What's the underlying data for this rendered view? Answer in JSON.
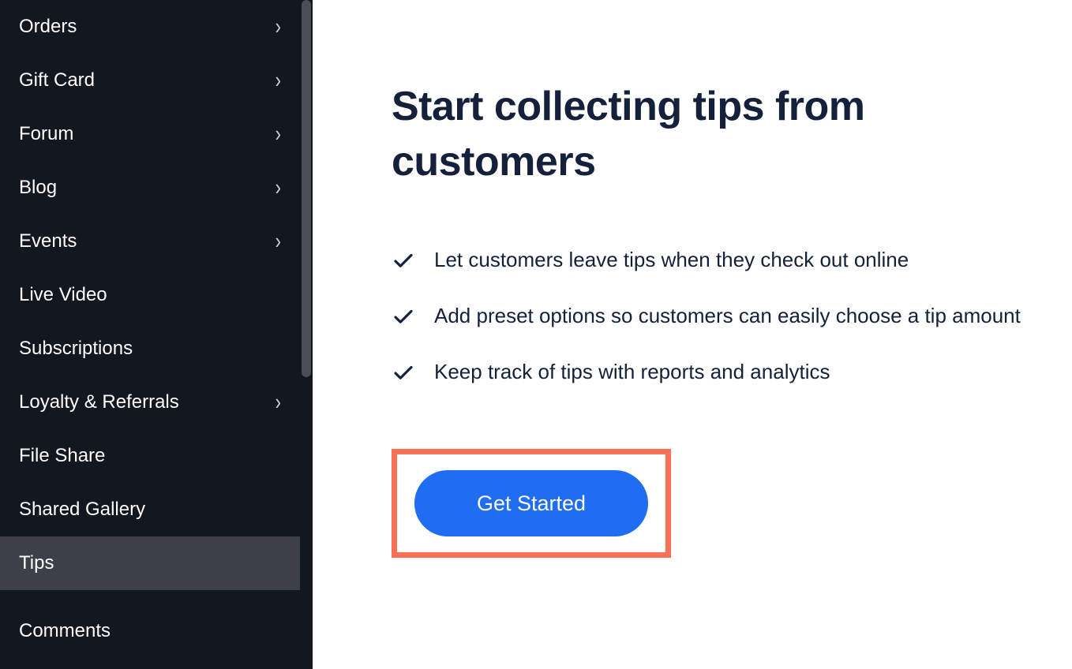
{
  "sidebar": {
    "items": [
      {
        "label": "Orders",
        "has_sub": true,
        "active": false
      },
      {
        "label": "Gift Card",
        "has_sub": true,
        "active": false
      },
      {
        "label": "Forum",
        "has_sub": true,
        "active": false
      },
      {
        "label": "Blog",
        "has_sub": true,
        "active": false
      },
      {
        "label": "Events",
        "has_sub": true,
        "active": false
      },
      {
        "label": "Live Video",
        "has_sub": false,
        "active": false
      },
      {
        "label": "Subscriptions",
        "has_sub": false,
        "active": false
      },
      {
        "label": "Loyalty & Referrals",
        "has_sub": true,
        "active": false
      },
      {
        "label": "File Share",
        "has_sub": false,
        "active": false
      },
      {
        "label": "Shared Gallery",
        "has_sub": false,
        "active": false
      },
      {
        "label": "Tips",
        "has_sub": false,
        "active": true
      }
    ],
    "after_divider": [
      {
        "label": "Comments",
        "has_sub": false,
        "active": false
      }
    ]
  },
  "main": {
    "title": "Start collecting tips from customers",
    "features": [
      "Let customers leave tips when they check out online",
      "Add preset options so customers can easily choose a tip amount",
      "Keep track of tips with reports and analytics"
    ],
    "cta_label": "Get Started"
  }
}
